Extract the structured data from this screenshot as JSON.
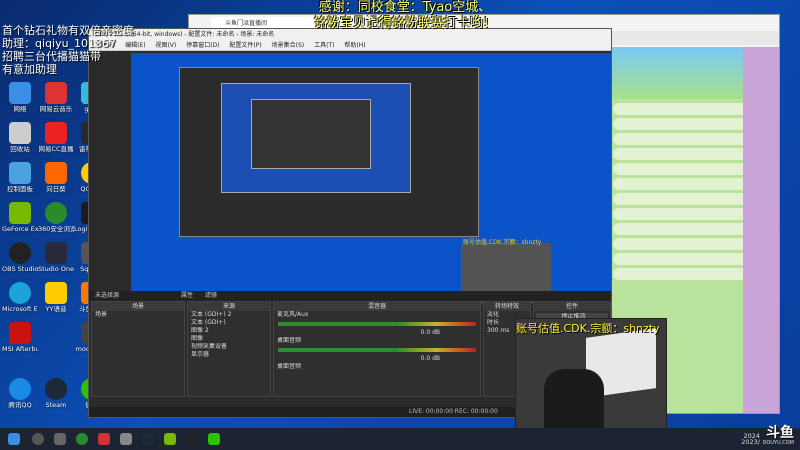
{
  "overlay_left": {
    "line1": "首个钻石礼物有双倍亲密度",
    "line2": "助理：qiqiyu_101367",
    "line3": "招聘三台代播猫猫带",
    "line4": "有意加助理"
  },
  "overlay_top": {
    "line1": "感谢：同校食堂：Tyao空城、",
    "line2": "铭粉宝贝记得铭粉联赛打卡哟！"
  },
  "desktop_icons": [
    {
      "label": "网络"
    },
    {
      "label": "网易云音乐"
    },
    {
      "label": "gwei"
    },
    {
      "label": "回收站"
    },
    {
      "label": "网易CC直播"
    },
    {
      "label": "雷神加速"
    },
    {
      "label": "控制面板"
    },
    {
      "label": "向日葵"
    },
    {
      "label": "QQ音乐"
    },
    {
      "label": "GeForce Experience"
    },
    {
      "label": "360安全浏览器"
    },
    {
      "label": "Logitech G HUB"
    },
    {
      "label": "OBS Studio"
    },
    {
      "label": "Studio One5"
    },
    {
      "label": "Squad_"
    },
    {
      "label": "Microsoft Edge"
    },
    {
      "label": "YY语音"
    },
    {
      "label": "斗鱼直播"
    },
    {
      "label": "MSI Afterburner"
    },
    {
      "label": "moonlight"
    },
    {
      "label": "腾讯QQ"
    },
    {
      "label": "Steam"
    },
    {
      "label": "微信"
    }
  ],
  "obs": {
    "title": "OBS 29.1.3 (64-bit, windows) - 配置文件: 未命名 - 场景: 未命名",
    "menu": [
      "文件(F)",
      "编辑(E)",
      "视图(V)",
      "停靠窗口(D)",
      "配置文件(P)",
      "场景集合(S)",
      "工具(T)",
      "帮助(H)"
    ],
    "source_bar": "未选择源",
    "properties": "属性",
    "filters": "滤镜",
    "docks": {
      "scenes": {
        "header": "场景",
        "items": [
          "场景"
        ]
      },
      "sources": {
        "header": "来源",
        "items": [
          "文本 (GDI+) 2",
          "文本 (GDI+)",
          "图像 2",
          "图像",
          "视频采集设备",
          "显示器"
        ]
      },
      "mixer": {
        "header": "混音器",
        "ch1": "麦克风/Aux",
        "ch2": "桌面音频",
        "ch3": "桌面音频",
        "level1": "0.0 dB",
        "level2": "0.0 dB"
      },
      "transitions": {
        "header": "转场特效",
        "type": "淡化",
        "duration_label": "时长",
        "duration": "300 ms"
      },
      "controls": {
        "header": "控件",
        "stop_stream": "停止推流"
      }
    },
    "status": "LIVE: 00:00:00   REC: 00:00:00"
  },
  "preview_cam_label": "账号估值.CDK.宗额：shnzty",
  "cam_label": "账号估值.CDK.宗额：shnzty",
  "browser": {
    "tab": "斗鱼门派直播间"
  },
  "tray": {
    "time": "2024",
    "date": "2023/",
    "brand": "斗鱼",
    "url": "DOUYU.COM"
  }
}
